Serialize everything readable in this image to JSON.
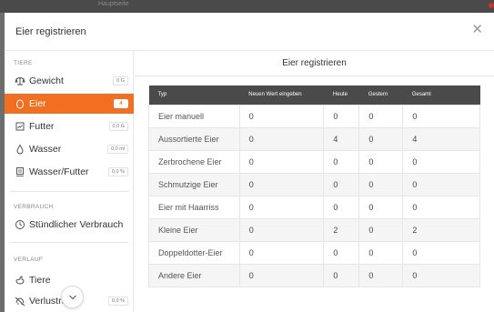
{
  "background": {
    "title": "Hauptseite"
  },
  "modal": {
    "title": "Eier registrieren",
    "close_icon": "close-icon"
  },
  "sidebar": {
    "sections": [
      {
        "title": "TIERE",
        "items": [
          {
            "label": "Gewicht",
            "badge": "0 G",
            "icon": "scale-icon",
            "active": false
          },
          {
            "label": "Eier",
            "badge": "4",
            "icon": "egg-icon",
            "active": true
          },
          {
            "label": "Futter",
            "badge": "0,0 G",
            "icon": "feed-icon",
            "active": false
          },
          {
            "label": "Wasser",
            "badge": "0,0 ml",
            "icon": "water-drop-icon",
            "active": false
          },
          {
            "label": "Wasser/Futter",
            "badge": "0,0 %",
            "icon": "ratio-icon",
            "active": false
          }
        ]
      },
      {
        "title": "VERBRAUCH",
        "items": [
          {
            "label": "Stündlicher Verbrauch",
            "icon": "clock-icon",
            "active": false
          }
        ]
      },
      {
        "title": "VERLAUF",
        "items": [
          {
            "label": "Tiere",
            "icon": "chicken-icon",
            "active": false
          },
          {
            "label": "Verlustra",
            "badge": "0,0 %",
            "icon": "loss-icon",
            "active": false
          }
        ]
      }
    ],
    "scroll_icon": "chevron-down-icon"
  },
  "main": {
    "title": "Eier registrieren",
    "table": {
      "headers": [
        "Typ",
        "Neuen Wert eingeben",
        "Heute",
        "Gestern",
        "Gesamt"
      ],
      "rows": [
        [
          "Eier manuell",
          "0",
          "0",
          "0",
          "0"
        ],
        [
          "Aussortierte Eier",
          "0",
          "4",
          "0",
          "4"
        ],
        [
          "Zerbrochene Eier",
          "0",
          "0",
          "0",
          "0"
        ],
        [
          "Schmutzige Eier",
          "0",
          "0",
          "0",
          "0"
        ],
        [
          "Eier mit Haarriss",
          "0",
          "0",
          "0",
          "0"
        ],
        [
          "Kleine Eier",
          "0",
          "2",
          "0",
          "2"
        ],
        [
          "Doppeldotter-Eier",
          "0",
          "0",
          "0",
          "0"
        ],
        [
          "Andere Eier",
          "0",
          "0",
          "0",
          "0"
        ]
      ]
    }
  },
  "colors": {
    "accent": "#f26f21",
    "table_header": "#4a4a4a",
    "modal_background": "#ffffff",
    "backdrop": "#6d6d6d"
  }
}
